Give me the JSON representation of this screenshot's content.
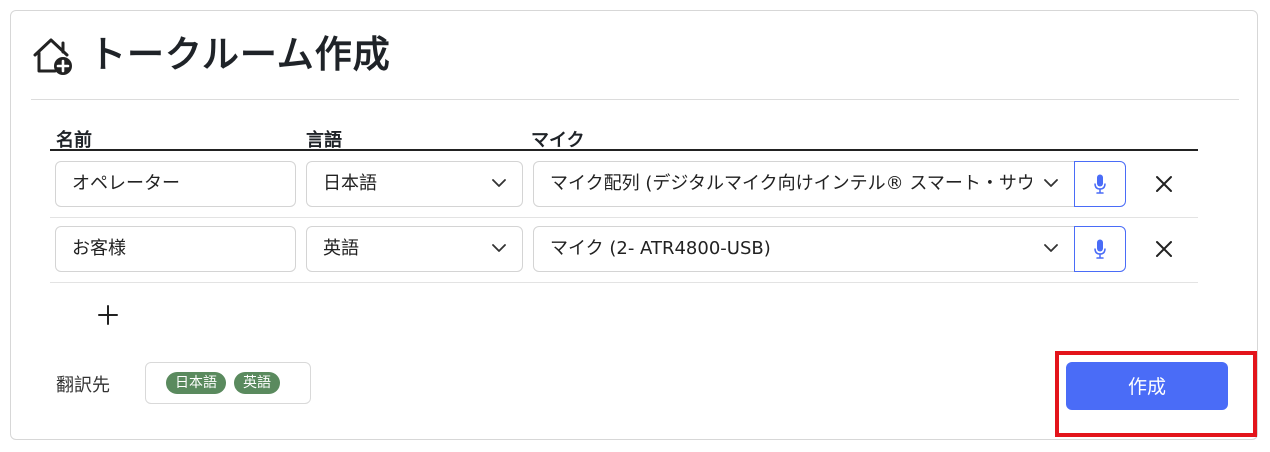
{
  "header": {
    "title": "トークルーム作成",
    "icon": "home-add-icon"
  },
  "table": {
    "columns": {
      "name": "名前",
      "language": "言語",
      "mic": "マイク"
    },
    "rows": [
      {
        "name": "オペレーター",
        "language": "日本語",
        "mic": "マイク配列 (デジタルマイク向けインテル® スマート・サウンド・テク"
      },
      {
        "name": "お客様",
        "language": "英語",
        "mic": "マイク (2- ATR4800-USB)"
      }
    ],
    "add_icon": "plus-icon",
    "remove_icon": "close-icon",
    "mic_icon": "microphone-icon"
  },
  "translation": {
    "label": "翻訳先",
    "targets": [
      "日本語",
      "英語"
    ]
  },
  "actions": {
    "create_label": "作成"
  },
  "colors": {
    "accent": "#4a6cf7",
    "chip": "#5a8a5e",
    "highlight": "#e3141b"
  }
}
